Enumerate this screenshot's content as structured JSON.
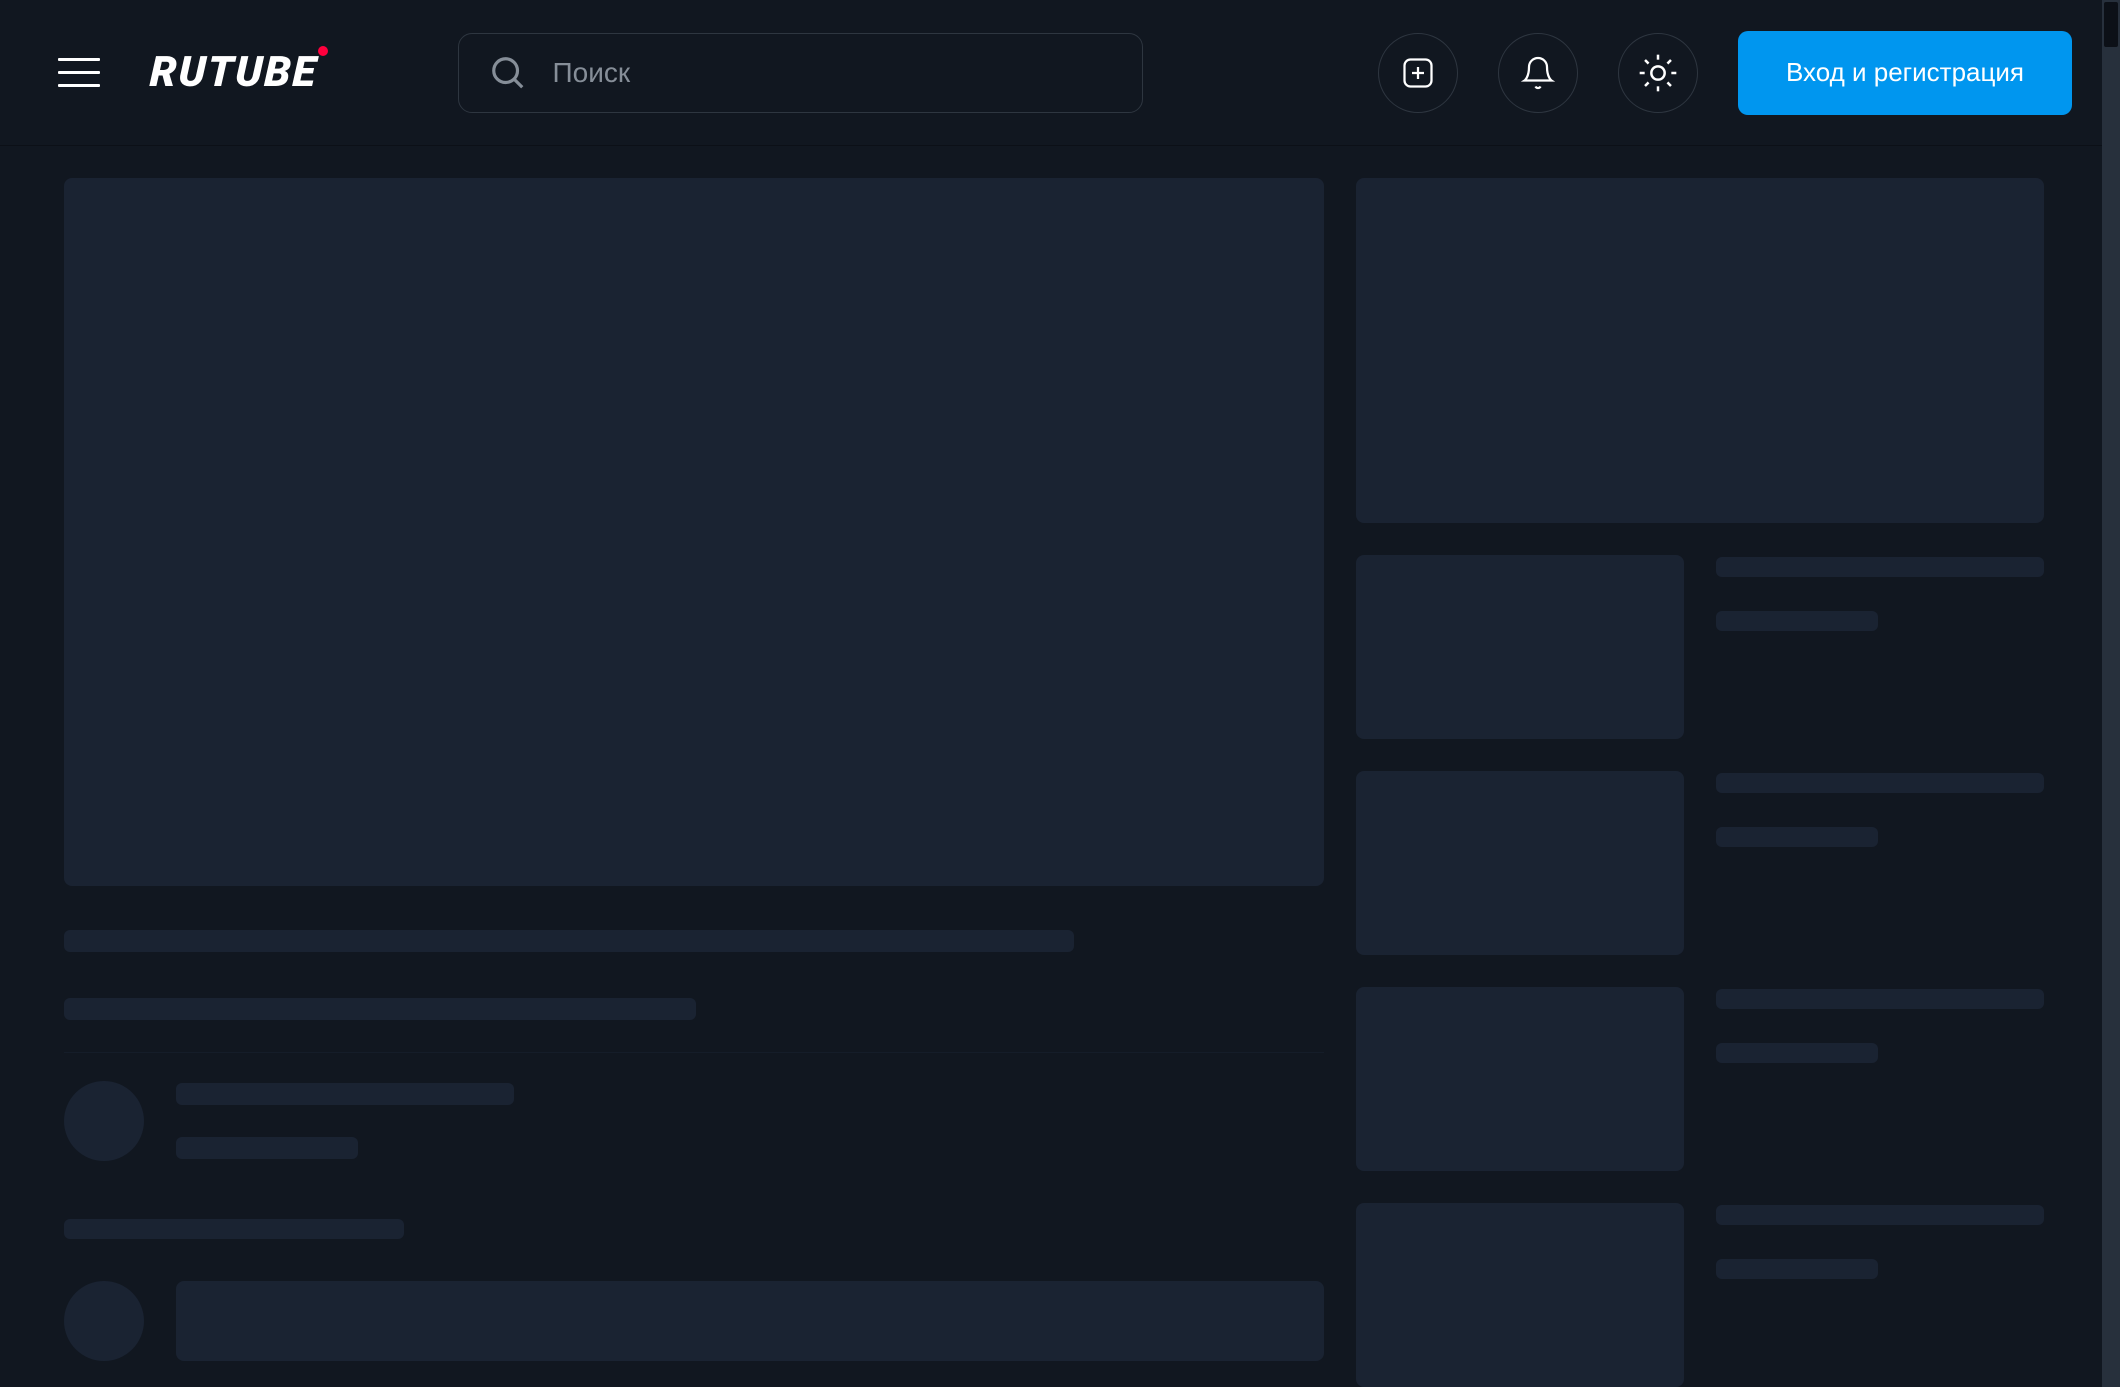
{
  "header": {
    "logo_text": "RUTUBE",
    "search_placeholder": "Поиск",
    "login_label": "Вход и регистрация"
  },
  "icons": {
    "hamburger": "hamburger-icon",
    "search": "search-icon",
    "add": "add-video-icon",
    "notifications": "bell-icon",
    "theme": "sun-icon"
  },
  "colors": {
    "accent": "#0096ef",
    "brand_dot": "#ff003d",
    "skeleton": "#1a2332",
    "background": "#111720",
    "page_background": "#0c1017"
  }
}
